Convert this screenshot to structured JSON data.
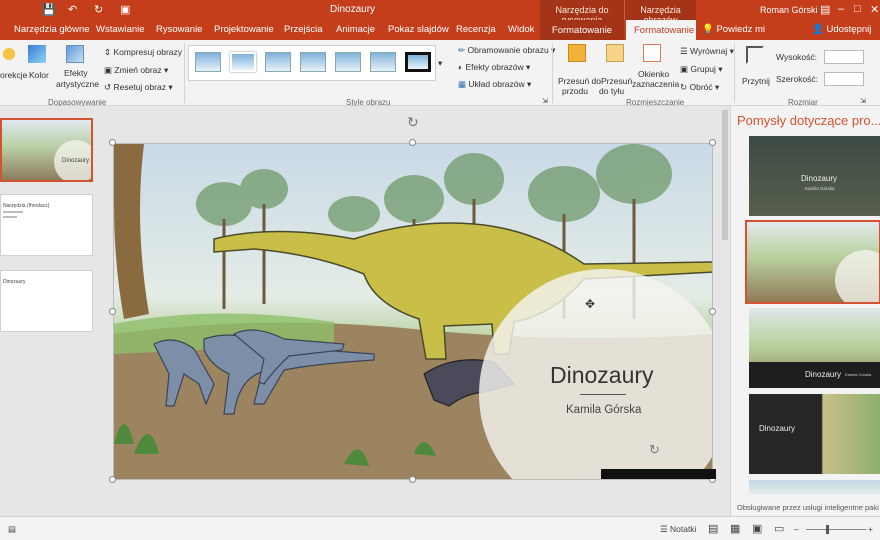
{
  "window": {
    "title": "Dinozaury",
    "user": "Roman Górski",
    "context_drawing": "Narzędzia do rysowania",
    "context_picture": "Narzędzia obrazów"
  },
  "tabs": {
    "home": "Narzędzia główne",
    "insert": "Wstawianie",
    "draw": "Rysowanie",
    "design": "Projektowanie",
    "transitions": "Przejścia",
    "animations": "Animacje",
    "slideshow": "Pokaz slajdów",
    "review": "Recenzja",
    "view": "Widok",
    "format_drawing": "Formatowanie",
    "format_picture": "Formatowanie",
    "tell_me": "Powiedz mi",
    "share": "Udostępnij"
  },
  "ribbon": {
    "adjust": {
      "corrections": "orekcje",
      "color": "Kolor",
      "artistic_1": "Efekty",
      "artistic_2": "artystyczne",
      "compress": "Kompresuj obrazy",
      "change": "Zmień obraz",
      "reset": "Resetuj obraz",
      "label": "Dopasowywanie"
    },
    "styles": {
      "label": "Style obrazu",
      "border": "Obramowanie obrazu",
      "effects": "Efekty obrazów",
      "layout": "Układ obrazów"
    },
    "arrange": {
      "forward_1": "Przesuń do",
      "forward_2": "przodu",
      "backward_1": "Przesuń",
      "backward_2": "do tyłu",
      "pane_1": "Okienko",
      "pane_2": "zaznaczenia",
      "align": "Wyrównaj",
      "group": "Grupuj",
      "rotate": "Obróć",
      "label": "Rozmieszczanie"
    },
    "size": {
      "crop": "Przytnij",
      "height": "Wysokość:",
      "width": "Szerokość:",
      "label": "Rozmiar"
    }
  },
  "thumbnails": {
    "slide1_title": "Dinozaury",
    "slide2_text": "Narzędzia (Ihrodacz)",
    "slide3_text": "Dinozaury"
  },
  "slide": {
    "title": "Dinozaury",
    "subtitle": "Kamila Górska"
  },
  "design_ideas": {
    "title": "Pomysły dotyczące pro...",
    "idea1_title": "Dinozaury",
    "idea1_sub": "Kamila Górska",
    "idea3_title": "Dinozaury",
    "idea3_sub": "Kamila Górska",
    "idea4_title": "Dinozaury",
    "footer": "Obsługiwane przez usługi inteligentne paki"
  },
  "status": {
    "notes": "Notatki"
  }
}
